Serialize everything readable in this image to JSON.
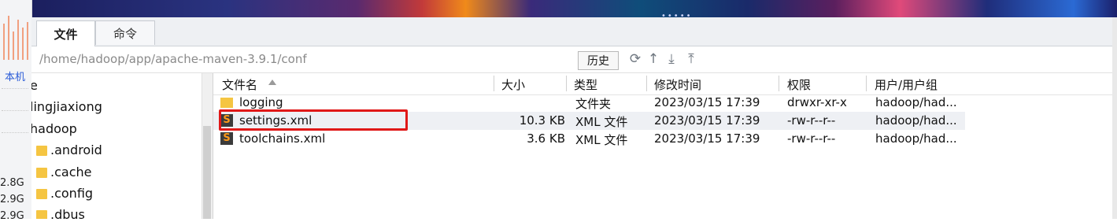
{
  "tabs": [
    {
      "label": "文件",
      "active": true
    },
    {
      "label": "命令",
      "active": false
    }
  ],
  "sidebar": {
    "local_label": "本机",
    "memory": [
      "2.8G",
      "2.9G",
      "2.9G"
    ]
  },
  "path": {
    "value": "/home/hadoop/app/apache-maven-3.9.1/conf",
    "history_label": "历史"
  },
  "toolbar_icons": [
    "refresh-icon",
    "up-icon",
    "download-icon",
    "upload-icon"
  ],
  "tree": {
    "items": [
      {
        "label": "e",
        "folder": false
      },
      {
        "label": "lingjiaxiong",
        "folder": false
      },
      {
        "label": "hadoop",
        "folder": false
      },
      {
        "label": ".android",
        "folder": true
      },
      {
        "label": ".cache",
        "folder": true
      },
      {
        "label": ".config",
        "folder": true
      },
      {
        "label": ".dbus",
        "folder": true
      }
    ]
  },
  "file_list": {
    "columns": [
      "文件名",
      "大小",
      "类型",
      "修改时间",
      "权限",
      "用户/用户组"
    ],
    "rows": [
      {
        "name": "logging",
        "size": "",
        "type": "文件夹",
        "modified": "2023/03/15 17:39",
        "permissions": "drwxr-xr-x",
        "owner": "hadoop/had...",
        "icon": "folder-icon"
      },
      {
        "name": "settings.xml",
        "size": "10.3 KB",
        "type": "XML 文件",
        "modified": "2023/03/15 17:39",
        "permissions": "-rw-r--r--",
        "owner": "hadoop/had...",
        "icon": "xml-file-icon"
      },
      {
        "name": "toolchains.xml",
        "size": "3.6 KB",
        "type": "XML 文件",
        "modified": "2023/03/15 17:39",
        "permissions": "-rw-r--r--",
        "owner": "hadoop/had...",
        "icon": "xml-file-icon"
      }
    ],
    "highlighted_row": 1,
    "highlight_color": "#e01818"
  },
  "colors": {
    "accent_link": "#2a5bd7",
    "folder": "#f5c542"
  }
}
